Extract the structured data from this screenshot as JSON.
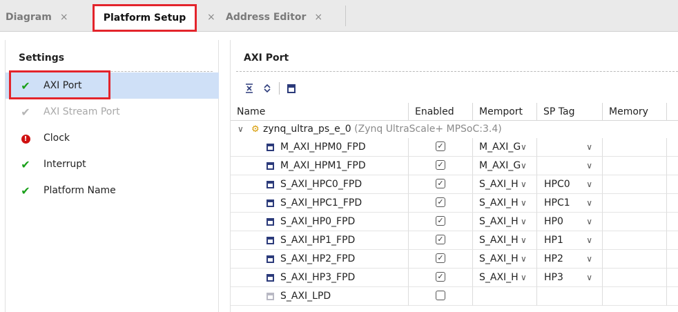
{
  "tabs": [
    {
      "label": "Diagram",
      "close": "×"
    },
    {
      "label": "Platform Setup",
      "close": "×"
    },
    {
      "label": "Address Editor",
      "close": "×"
    }
  ],
  "settings": {
    "title": "Settings",
    "items": [
      {
        "label": "AXI Port",
        "status": "ok"
      },
      {
        "label": "AXI Stream Port",
        "status": "disabled"
      },
      {
        "label": "Clock",
        "status": "error"
      },
      {
        "label": "Interrupt",
        "status": "ok"
      },
      {
        "label": "Platform Name",
        "status": "ok"
      }
    ]
  },
  "axi": {
    "title": "AXI Port",
    "toolbar": [
      "collapse-all-icon",
      "expand-all-icon",
      "port-icon"
    ],
    "columns": [
      "Name",
      "Enabled",
      "Memport",
      "SP Tag",
      "Memory"
    ],
    "group": {
      "name": "zynq_ultra_ps_e_0",
      "sub": "(Zynq UltraScale+ MPSoC:3.4)"
    },
    "rows": [
      {
        "name": "M_AXI_HPM0_FPD",
        "enabled": true,
        "memport": "M_AXI_G",
        "sptag": ""
      },
      {
        "name": "M_AXI_HPM1_FPD",
        "enabled": true,
        "memport": "M_AXI_G",
        "sptag": ""
      },
      {
        "name": "S_AXI_HPC0_FPD",
        "enabled": true,
        "memport": "S_AXI_H",
        "sptag": "HPC0"
      },
      {
        "name": "S_AXI_HPC1_FPD",
        "enabled": true,
        "memport": "S_AXI_H",
        "sptag": "HPC1"
      },
      {
        "name": "S_AXI_HP0_FPD",
        "enabled": true,
        "memport": "S_AXI_H",
        "sptag": "HP0"
      },
      {
        "name": "S_AXI_HP1_FPD",
        "enabled": true,
        "memport": "S_AXI_H",
        "sptag": "HP1"
      },
      {
        "name": "S_AXI_HP2_FPD",
        "enabled": true,
        "memport": "S_AXI_H",
        "sptag": "HP2"
      },
      {
        "name": "S_AXI_HP3_FPD",
        "enabled": true,
        "memport": "S_AXI_H",
        "sptag": "HP3"
      },
      {
        "name": "S_AXI_LPD",
        "enabled": false,
        "memport": "",
        "sptag": ""
      }
    ]
  },
  "colors": {
    "highlight": "#e3242b",
    "selected": "#cfe0f7",
    "ok": "#1aa01a",
    "error": "#d01010"
  }
}
